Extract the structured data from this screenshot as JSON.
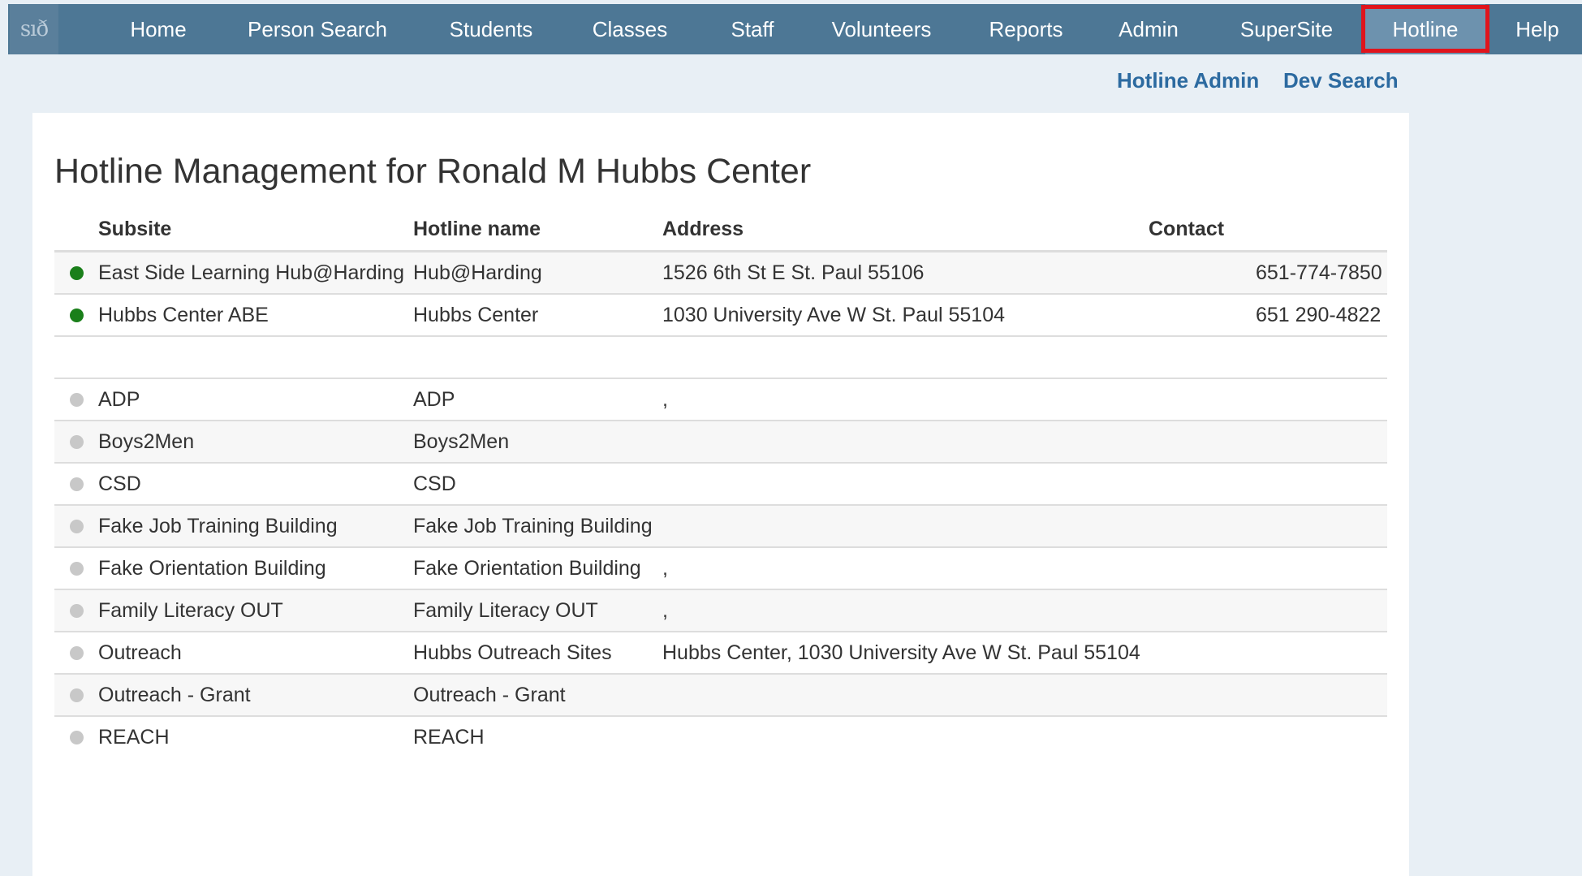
{
  "app": {
    "logo_text": "sıð"
  },
  "nav": {
    "items": [
      {
        "label": "Home",
        "active": false
      },
      {
        "label": "Person Search",
        "active": false
      },
      {
        "label": "Students",
        "active": false
      },
      {
        "label": "Classes",
        "active": false
      },
      {
        "label": "Staff",
        "active": false
      },
      {
        "label": "Volunteers",
        "active": false
      },
      {
        "label": "Reports",
        "active": false
      },
      {
        "label": "Admin",
        "active": false
      },
      {
        "label": "SuperSite",
        "active": false
      },
      {
        "label": "Hotline",
        "active": true
      },
      {
        "label": "Help",
        "active": false
      }
    ]
  },
  "subnav": {
    "hotline_admin": "Hotline Admin",
    "dev_search": "Dev Search"
  },
  "page": {
    "title": "Hotline Management for Ronald M Hubbs Center"
  },
  "table": {
    "headers": {
      "subsite": "Subsite",
      "hotline_name": "Hotline name",
      "address": "Address",
      "contact": "Contact"
    },
    "rows": [
      {
        "status": "active",
        "subsite": "East Side Learning Hub@Harding",
        "hotline_name": "Hub@Harding",
        "address": "1526 6th St E St. Paul 55106",
        "contact": "651-774-7850"
      },
      {
        "status": "active",
        "subsite": "Hubbs Center ABE",
        "hotline_name": "Hubbs Center",
        "address": "1030 University Ave W St. Paul 55104",
        "contact": "651 290-4822"
      },
      {
        "status": "inactive",
        "subsite": "ADP",
        "hotline_name": "ADP",
        "address": ",",
        "contact": ""
      },
      {
        "status": "inactive",
        "subsite": "Boys2Men",
        "hotline_name": "Boys2Men",
        "address": "",
        "contact": ""
      },
      {
        "status": "inactive",
        "subsite": "CSD",
        "hotline_name": "CSD",
        "address": "",
        "contact": ""
      },
      {
        "status": "inactive",
        "subsite": "Fake Job Training Building",
        "hotline_name": "Fake Job Training Building",
        "address": "",
        "contact": ""
      },
      {
        "status": "inactive",
        "subsite": "Fake Orientation Building",
        "hotline_name": "Fake Orientation Building",
        "address": ",",
        "contact": ""
      },
      {
        "status": "inactive",
        "subsite": "Family Literacy OUT",
        "hotline_name": "Family Literacy OUT",
        "address": ",",
        "contact": ""
      },
      {
        "status": "inactive",
        "subsite": "Outreach",
        "hotline_name": "Hubbs Outreach Sites",
        "address": "Hubbs Center, 1030 University Ave W St. Paul 55104",
        "contact": ""
      },
      {
        "status": "inactive",
        "subsite": "Outreach - Grant",
        "hotline_name": "Outreach - Grant",
        "address": "",
        "contact": ""
      },
      {
        "status": "inactive",
        "subsite": "REACH",
        "hotline_name": "REACH",
        "address": "",
        "contact": ""
      }
    ]
  },
  "colors": {
    "nav_bg": "#4d7795",
    "active_dot": "#1a7f1a",
    "inactive_dot": "#c8c8c8",
    "highlight": "#e0141c",
    "link": "#2c6aa0"
  }
}
